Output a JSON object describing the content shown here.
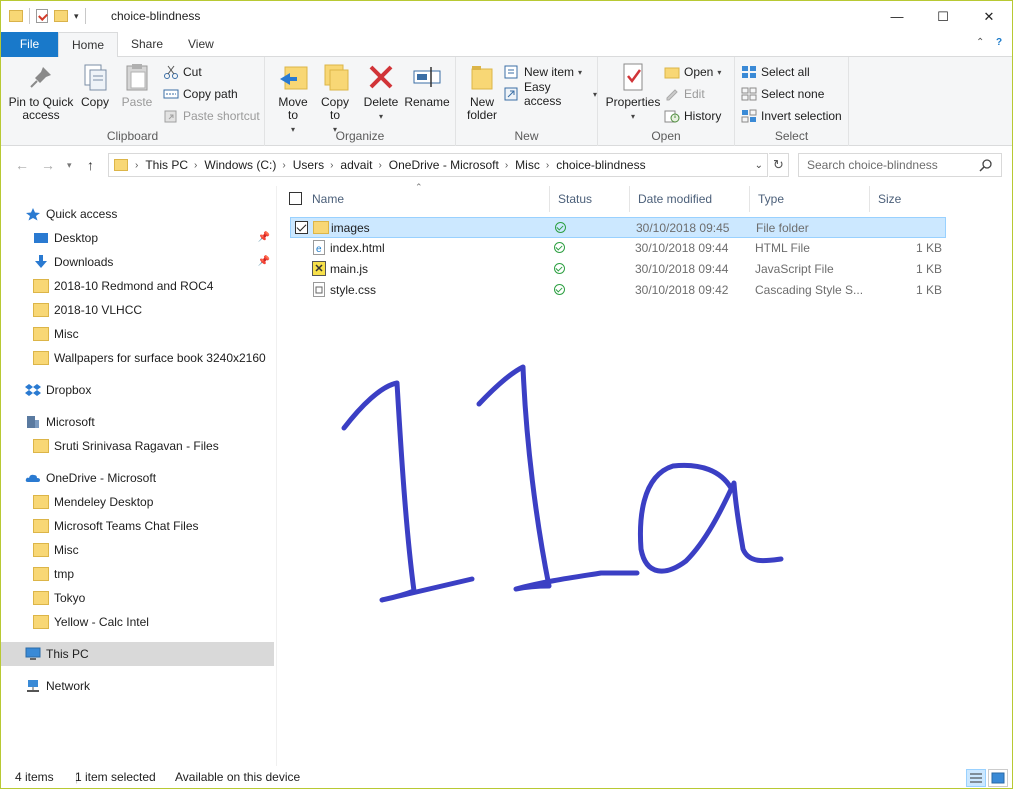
{
  "window": {
    "title": "choice-blindness"
  },
  "ribbon_tabs": {
    "file": "File",
    "home": "Home",
    "share": "Share",
    "view": "View"
  },
  "ribbon": {
    "clipboard": {
      "label": "Clipboard",
      "pin": "Pin to Quick access",
      "copy": "Copy",
      "paste": "Paste",
      "cut": "Cut",
      "copy_path": "Copy path",
      "paste_shortcut": "Paste shortcut"
    },
    "organize": {
      "label": "Organize",
      "move_to": "Move to",
      "copy_to": "Copy to",
      "delete": "Delete",
      "rename": "Rename"
    },
    "new": {
      "label": "New",
      "new_folder": "New folder",
      "new_item": "New item",
      "easy_access": "Easy access"
    },
    "open": {
      "label": "Open",
      "properties": "Properties",
      "open": "Open",
      "edit": "Edit",
      "history": "History"
    },
    "select": {
      "label": "Select",
      "select_all": "Select all",
      "select_none": "Select none",
      "invert_selection": "Invert selection"
    }
  },
  "address": {
    "crumbs": [
      "This PC",
      "Windows (C:)",
      "Users",
      "advait",
      "OneDrive - Microsoft",
      "Misc",
      "choice-blindness"
    ],
    "search_placeholder": "Search choice-blindness"
  },
  "nav": {
    "quick_access": "Quick access",
    "items": [
      {
        "label": "Desktop",
        "icon": "desktop-icon",
        "pinned": true
      },
      {
        "label": "Downloads",
        "icon": "downloads-icon",
        "pinned": true
      },
      {
        "label": "2018-10 Redmond and ROC4",
        "icon": "folder-icon"
      },
      {
        "label": "2018-10 VLHCC",
        "icon": "folder-icon"
      },
      {
        "label": "Misc",
        "icon": "folder-icon"
      },
      {
        "label": "Wallpapers for surface book 3240x2160",
        "icon": "folder-icon"
      }
    ],
    "dropbox": "Dropbox",
    "microsoft": "Microsoft",
    "microsoft_items": [
      "Sruti Srinivasa Ragavan - Files"
    ],
    "onedrive": "OneDrive - Microsoft",
    "onedrive_items": [
      "Mendeley Desktop",
      "Microsoft Teams Chat Files",
      "Misc",
      "tmp",
      "Tokyo",
      "Yellow - Calc Intel"
    ],
    "this_pc": "This PC",
    "network": "Network"
  },
  "columns": {
    "name": "Name",
    "status": "Status",
    "date": "Date modified",
    "type": "Type",
    "size": "Size"
  },
  "files": [
    {
      "name": "images",
      "date": "30/10/2018 09:45",
      "type": "File folder",
      "size": "",
      "icon": "folder-icon",
      "selected": true
    },
    {
      "name": "index.html",
      "date": "30/10/2018 09:44",
      "type": "HTML File",
      "size": "1 KB",
      "icon": "html-file-icon",
      "selected": false
    },
    {
      "name": "main.js",
      "date": "30/10/2018 09:44",
      "type": "JavaScript File",
      "size": "1 KB",
      "icon": "js-file-icon",
      "selected": false
    },
    {
      "name": "style.css",
      "date": "30/10/2018 09:42",
      "type": "Cascading Style S...",
      "size": "1 KB",
      "icon": "css-file-icon",
      "selected": false
    }
  ],
  "statusbar": {
    "count": "4 items",
    "selected": "1 item selected",
    "availability": "Available on this device"
  },
  "handwriting": {
    "text": "11a",
    "color": "#3b3fc4"
  },
  "colors": {
    "accent": "#1979ca",
    "selection": "#cce8ff",
    "border": "#b8c933"
  }
}
